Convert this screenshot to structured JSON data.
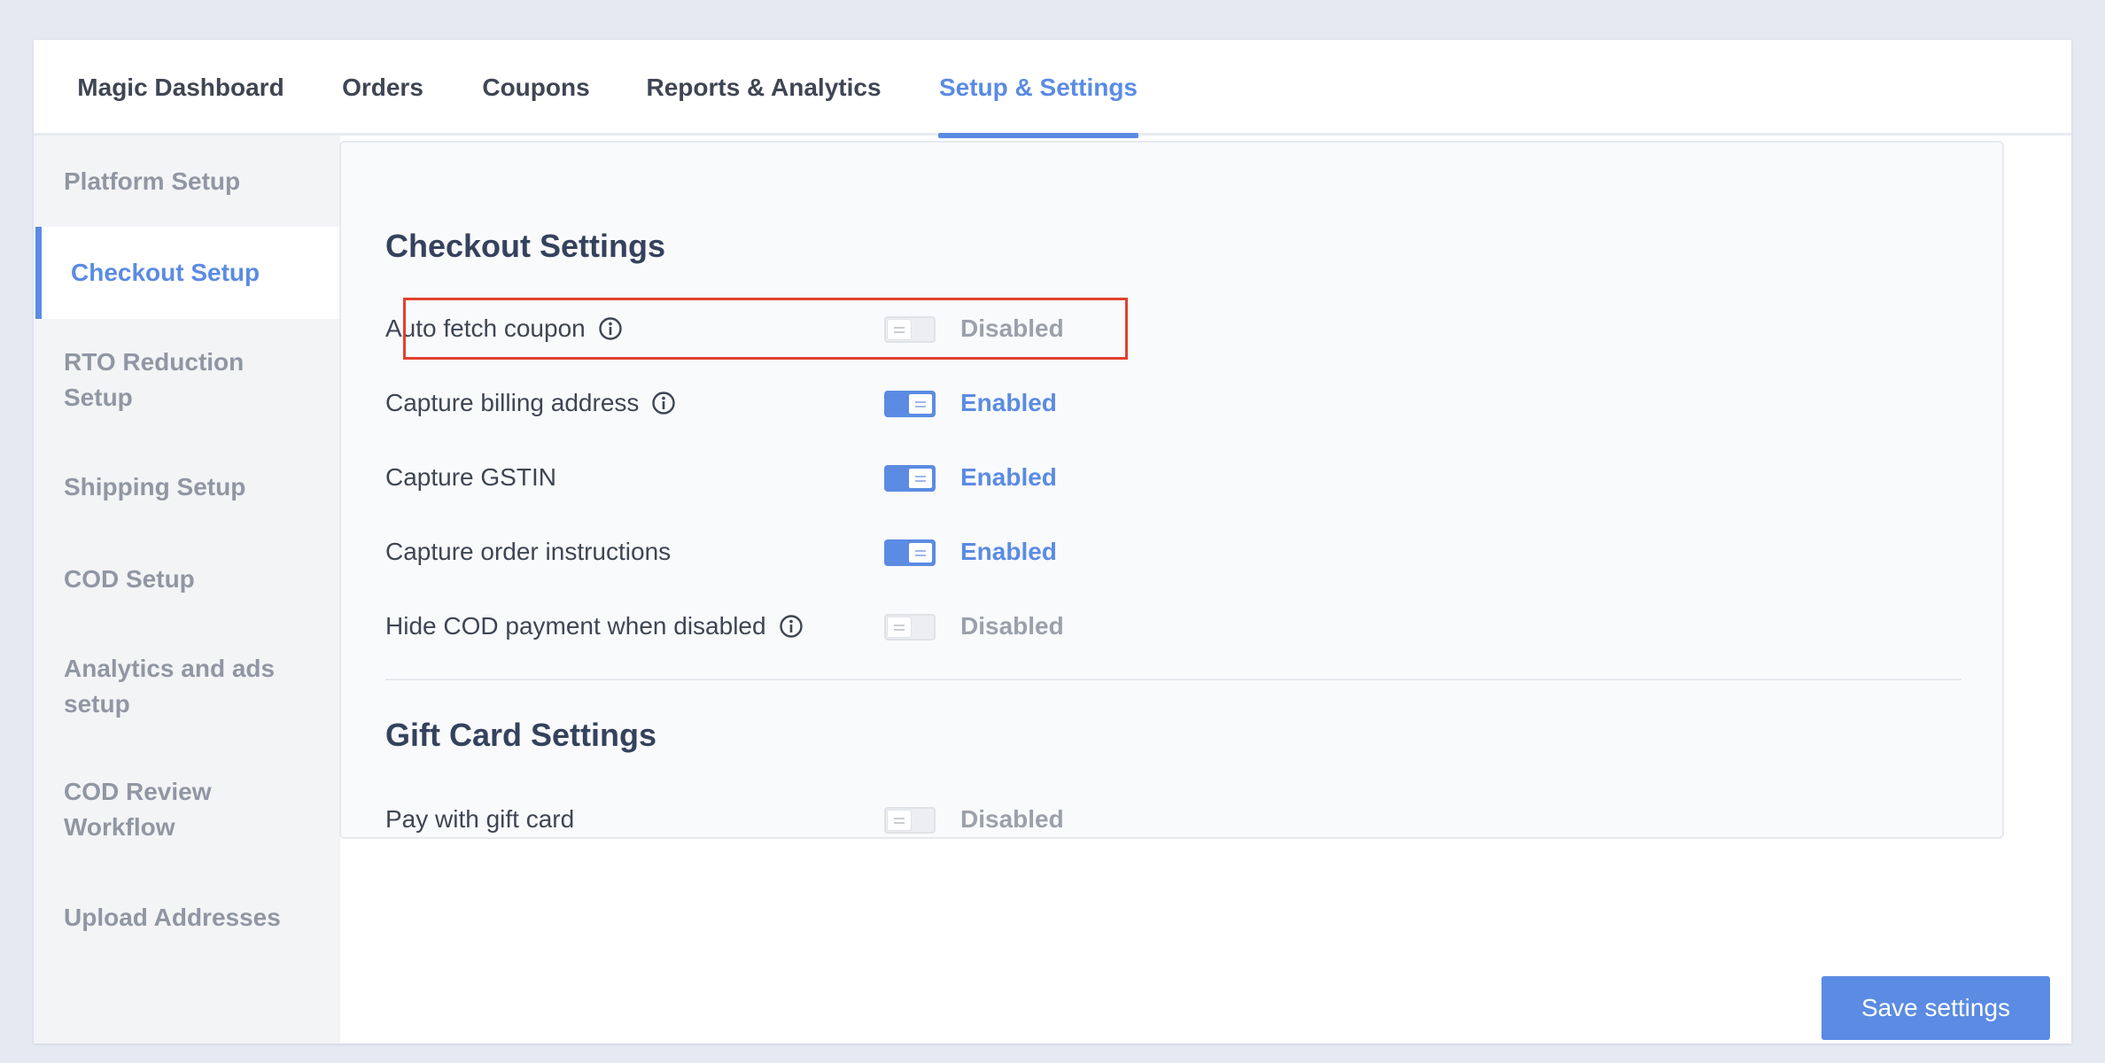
{
  "topnav": {
    "tabs": [
      {
        "label": "Magic Dashboard"
      },
      {
        "label": "Orders"
      },
      {
        "label": "Coupons"
      },
      {
        "label": "Reports & Analytics"
      },
      {
        "label": "Setup & Settings",
        "active": true
      }
    ]
  },
  "sidebar": {
    "items": [
      {
        "label": "Platform Setup"
      },
      {
        "label": "Checkout Setup",
        "active": true
      },
      {
        "label": "RTO Reduction Setup"
      },
      {
        "label": "Shipping Setup"
      },
      {
        "label": "COD Setup"
      },
      {
        "label": "Analytics and ads setup"
      },
      {
        "label": "COD Review Workflow"
      },
      {
        "label": "Upload Addresses"
      }
    ]
  },
  "checkout": {
    "title": "Checkout Settings",
    "rows": [
      {
        "label": "Auto fetch coupon",
        "info_icon": true,
        "enabled": false,
        "status": "Disabled"
      },
      {
        "label": "Capture billing address",
        "info_icon": true,
        "enabled": true,
        "status": "Enabled"
      },
      {
        "label": "Capture GSTIN",
        "info_icon": false,
        "enabled": true,
        "status": "Enabled"
      },
      {
        "label": "Capture order instructions",
        "info_icon": false,
        "enabled": true,
        "status": "Enabled"
      },
      {
        "label": "Hide COD payment when disabled",
        "info_icon": true,
        "enabled": false,
        "status": "Disabled"
      }
    ]
  },
  "gift_card": {
    "title": "Gift Card Settings",
    "rows": [
      {
        "label": "Pay with gift card",
        "info_icon": false,
        "enabled": false,
        "status": "Disabled"
      }
    ]
  },
  "actions": {
    "save_label": "Save settings"
  },
  "colors": {
    "accent": "#5b8be3",
    "highlight": "#e0412e",
    "page_bg": "#e5e9f1",
    "sidebar_bg": "#f3f4f6"
  }
}
